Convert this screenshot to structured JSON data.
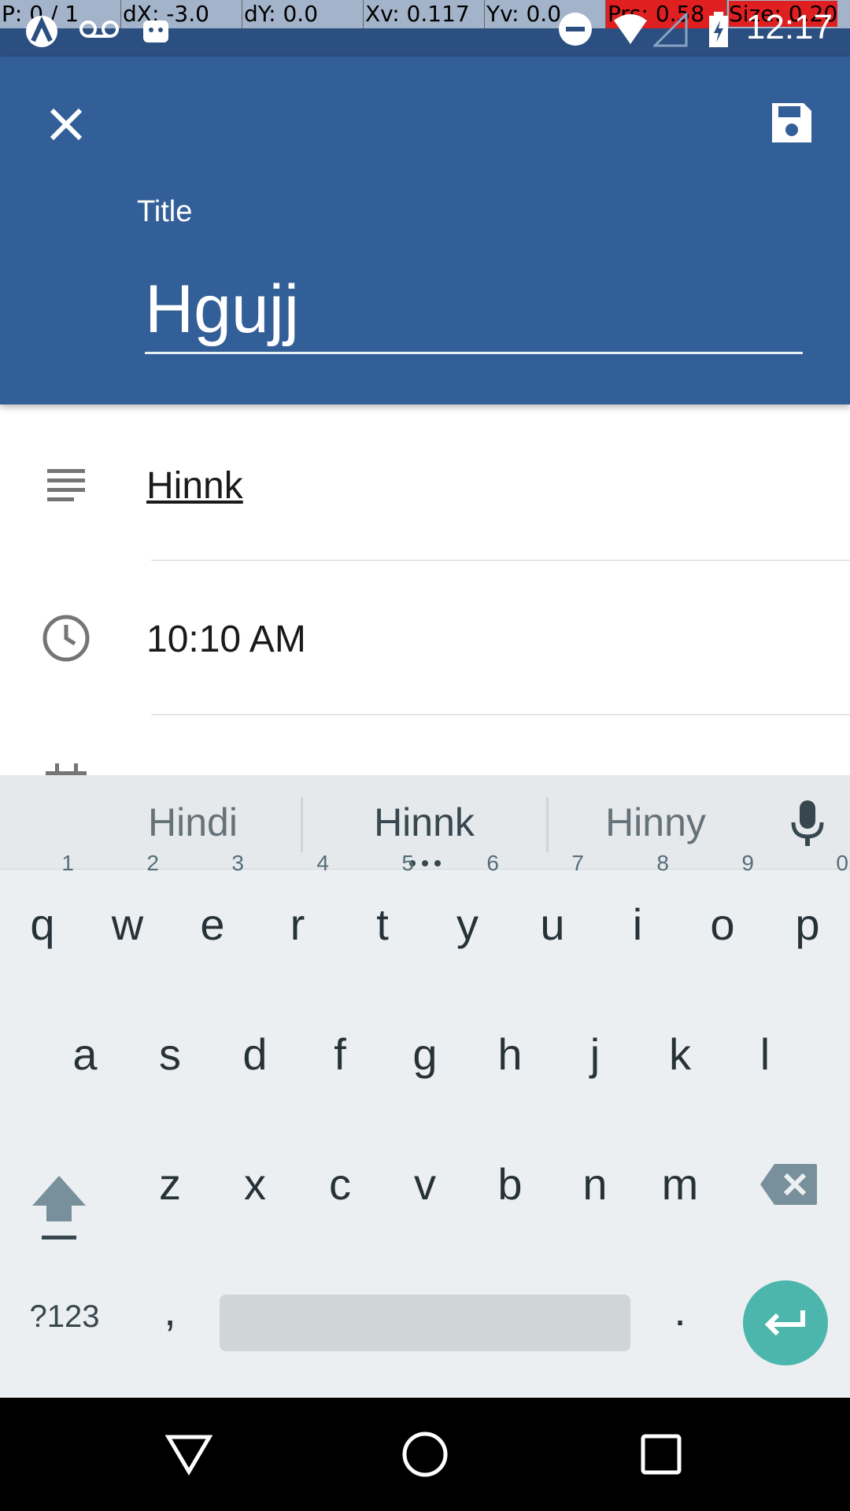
{
  "status_bar": {
    "pointer": {
      "p": "P: 0 / 1",
      "dx": "dX: -3.0",
      "dy": "dY: 0.0",
      "xv": "Xv: 0.117",
      "yv": "Yv: 0.0",
      "prs": "Prs: 0.58",
      "size": "Size: 0.20"
    },
    "time": "12:17"
  },
  "appbar": {
    "title_label": "Title",
    "title_value": "Hgujj"
  },
  "form": {
    "description": "Hinnk",
    "time": "10:10 AM"
  },
  "keyboard": {
    "suggestions": [
      "Hindi",
      "Hinnk",
      "Hinny"
    ],
    "row1": [
      {
        "key": "q",
        "hint": "1"
      },
      {
        "key": "w",
        "hint": "2"
      },
      {
        "key": "e",
        "hint": "3"
      },
      {
        "key": "r",
        "hint": "4"
      },
      {
        "key": "t",
        "hint": "5"
      },
      {
        "key": "y",
        "hint": "6"
      },
      {
        "key": "u",
        "hint": "7"
      },
      {
        "key": "i",
        "hint": "8"
      },
      {
        "key": "o",
        "hint": "9"
      },
      {
        "key": "p",
        "hint": "0"
      }
    ],
    "row2": [
      "a",
      "s",
      "d",
      "f",
      "g",
      "h",
      "j",
      "k",
      "l"
    ],
    "row3": [
      "z",
      "x",
      "c",
      "v",
      "b",
      "n",
      "m"
    ],
    "symbols_key": "?123",
    "comma_key": ",",
    "period_key": "."
  },
  "colors": {
    "appbar": "#335f98",
    "statusbar": "#2b4f80",
    "enter_key": "#4db6ac"
  },
  "icons": {
    "close": "close-icon",
    "save": "save-icon",
    "description": "notes-icon",
    "time": "clock-icon",
    "date": "calendar-icon",
    "mic": "mic-icon",
    "shift": "shift-icon",
    "backspace": "backspace-icon",
    "enter": "enter-icon",
    "back": "back-icon",
    "home": "home-icon",
    "recents": "recents-icon"
  }
}
